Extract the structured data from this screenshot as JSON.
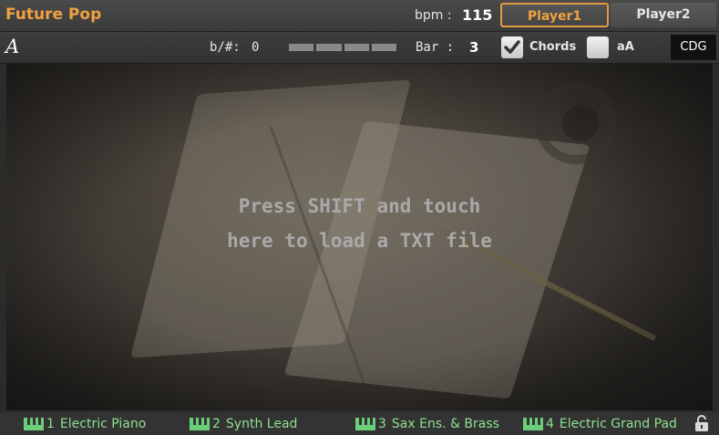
{
  "header": {
    "song_title": "Future Pop",
    "bpm_label": "bpm :",
    "bpm_value": "115",
    "player1_label": "Player1",
    "player2_label": "Player2"
  },
  "toolbar": {
    "font_glyph": "A",
    "transpose_label": "b/#:",
    "transpose_value": "0",
    "progress_segments": 4,
    "bar_label": "Bar :",
    "bar_value": "3",
    "chords_label": "Chords",
    "chords_checked": true,
    "aa_label": "aA",
    "aa_checked": false,
    "cdg_label": "CDG"
  },
  "main": {
    "message_line1": "Press SHIFT and touch",
    "message_line2": "here to load a TXT file"
  },
  "tracks": [
    {
      "num": "1",
      "name": "Electric Piano"
    },
    {
      "num": "2",
      "name": "Synth Lead"
    },
    {
      "num": "3",
      "name": "Sax Ens. & Brass"
    },
    {
      "num": "4",
      "name": "Electric Grand Pad"
    }
  ],
  "colors": {
    "accent": "#f0a040",
    "track_green": "#8de08f",
    "background": "#2b2b2b"
  },
  "icons": {
    "checkbox_chords": "check-icon",
    "keyboard": "keyboard-icon",
    "lock": "unlocked-padlock-icon"
  }
}
